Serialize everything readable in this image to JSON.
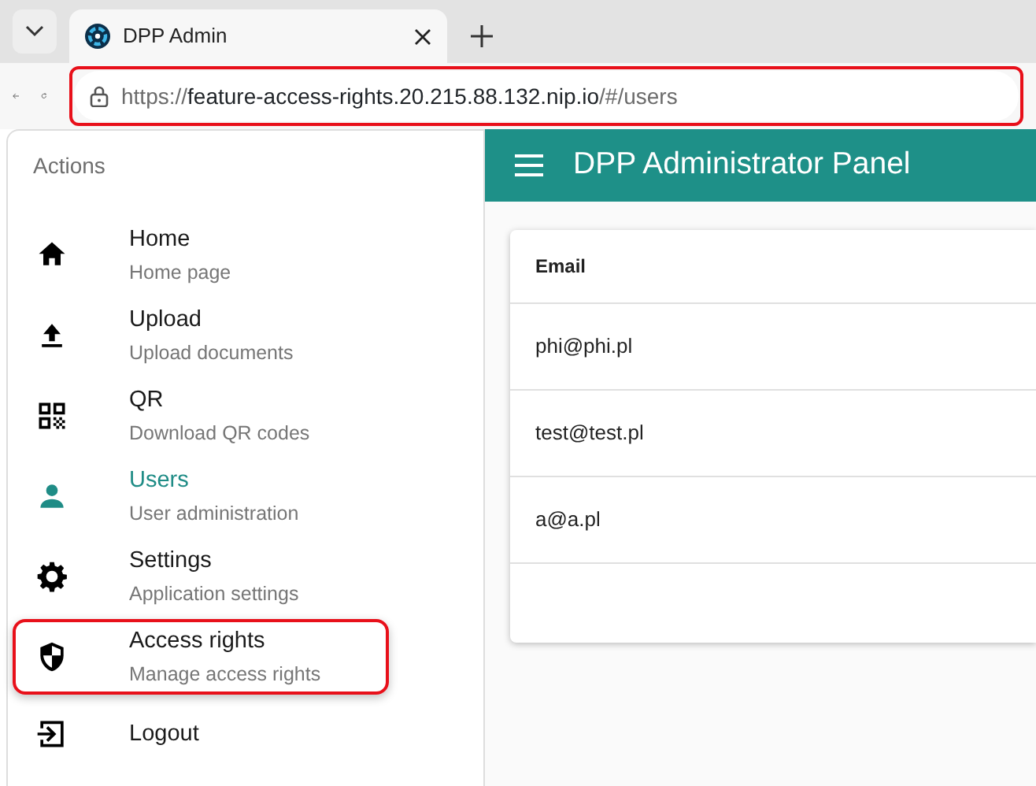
{
  "browser": {
    "tabs": [
      {
        "title": "DPP Admin",
        "selected": true
      }
    ],
    "url": {
      "scheme": "https://",
      "host": "feature-access-rights.20.215.88.132.nip.io",
      "path": "/#/users",
      "highlighted": true
    }
  },
  "sidebar": {
    "heading": "Actions",
    "items": [
      {
        "title": "Home",
        "subtitle": "Home page",
        "selected": false,
        "highlighted": false
      },
      {
        "title": "Upload",
        "subtitle": "Upload documents",
        "selected": false,
        "highlighted": false
      },
      {
        "title": "QR",
        "subtitle": "Download QR codes",
        "selected": false,
        "highlighted": false
      },
      {
        "title": "Users",
        "subtitle": "User administration",
        "selected": true,
        "highlighted": false
      },
      {
        "title": "Settings",
        "subtitle": "Application settings",
        "selected": false,
        "highlighted": false
      },
      {
        "title": "Access rights",
        "subtitle": "Manage access rights",
        "selected": false,
        "highlighted": true
      },
      {
        "title": "Logout",
        "selected": false,
        "highlighted": false
      }
    ]
  },
  "header": {
    "title": "DPP Administrator Panel"
  },
  "table": {
    "columns": [
      "Email"
    ],
    "rows": [
      [
        "phi@phi.pl"
      ],
      [
        "test@test.pl"
      ],
      [
        "a@a.pl"
      ]
    ]
  }
}
